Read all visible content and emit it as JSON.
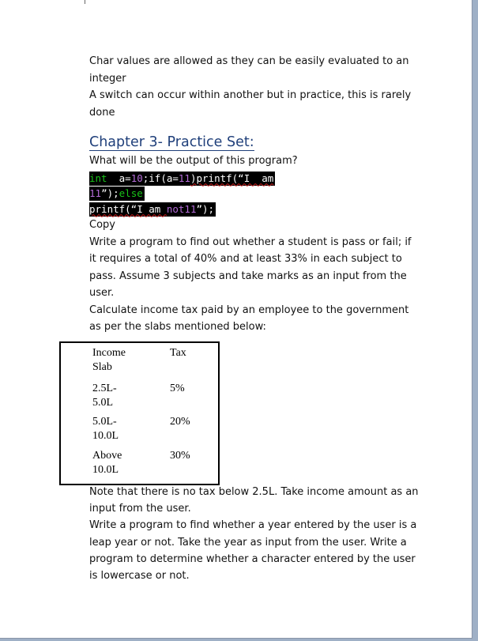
{
  "intro_lines": [
    "Char values are allowed as they can be easily evaluated to an",
    "integer",
    "A switch can occur within another but in practice, this is rarely",
    "done"
  ],
  "heading": "Chapter 3- Practice Set:",
  "question1": "What will be the output of this program?",
  "code": {
    "line1_kw": "int",
    "line1_a": "  a=",
    "line1_n1": "10",
    "line1_b": ";if(a=",
    "line1_n2": "11",
    "line1_c": ")printf(“I  am",
    "line2_n": "11",
    "line2_b": "”);",
    "line2_kw": "else",
    "line3_a": "printf(“I am ",
    "line3_n": "not11",
    "line3_b": "”);"
  },
  "copy_label": "Copy",
  "question2_lines": [
    "Write a program to find out whether a student is pass or fail; if",
    "it requires a total of 40% and at least 33% in each subject to",
    "pass. Assume 3 subjects and take marks as an input from the",
    "user."
  ],
  "question3_lines": [
    "Calculate income tax paid by an employee to the government",
    "as per the slabs mentioned below:"
  ],
  "table": {
    "headers": [
      "Income Slab",
      "Tax"
    ],
    "rows": [
      {
        "slab_l1": "2.5L-",
        "slab_l2": "5.0L",
        "tax": "5%"
      },
      {
        "slab_l1": "5.0L-",
        "slab_l2": "10.0L",
        "tax": "20%"
      },
      {
        "slab_l1": "Above",
        "slab_l2": "10.0L",
        "tax": "30%"
      }
    ],
    "header_l1": "Income",
    "header_l2": "Slab"
  },
  "after_lines": [
    "Note that there is no tax below 2.5L. Take income amount as an",
    "input from the user.",
    "Write a program to find whether a year entered by the user is a",
    "leap year or not. Take the year as input from the user. Write a",
    "program to determine whether a character entered by the user",
    "is lowercase or not."
  ]
}
